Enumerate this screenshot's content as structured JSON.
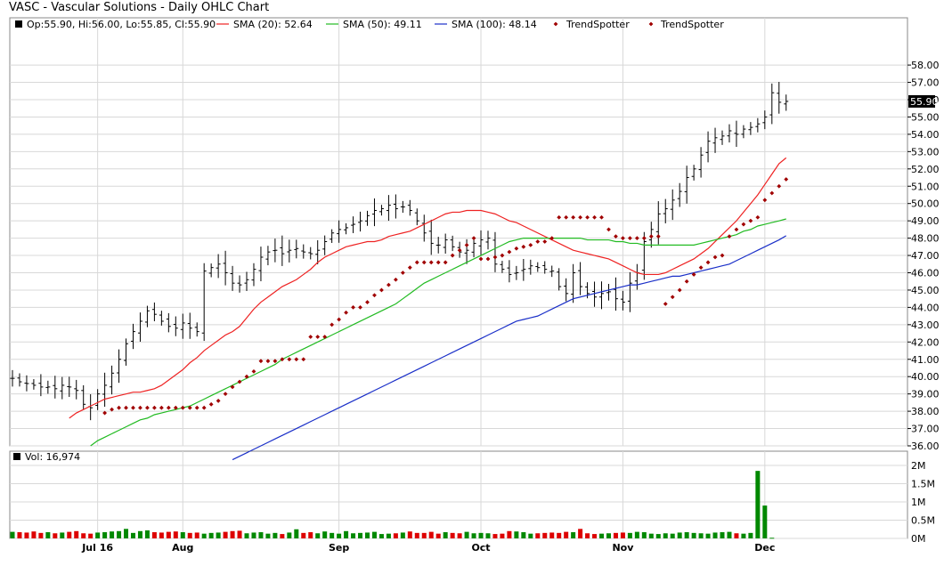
{
  "title": "VASC - Vascular Solutions - Daily OHLC Chart",
  "legend": {
    "ohlc": "Op:55.90, Hi:56.00, Lo:55.85, Cl:55.90",
    "sma20": "SMA (20): 52.64",
    "sma50": "SMA (50): 49.11",
    "sma100": "SMA (100): 48.14",
    "trend1": "TrendSpotter",
    "trend2": "TrendSpotter"
  },
  "volume_label": "Vol: 16,974",
  "last_price_tag": "55.90",
  "colors": {
    "sma20": "#ee2222",
    "sma50": "#22bb22",
    "sma100": "#1a2fc8",
    "trend": "#a00000",
    "vol_up": "#008800",
    "vol_down": "#dd0000",
    "grid": "#d8d8d8"
  },
  "chart_data": {
    "type": "ohlc",
    "price_axis": {
      "range": [
        36,
        58
      ],
      "ticks": [
        "36.00",
        "37.00",
        "38.00",
        "39.00",
        "40.00",
        "41.00",
        "42.00",
        "43.00",
        "44.00",
        "45.00",
        "46.00",
        "47.00",
        "48.00",
        "49.00",
        "50.00",
        "51.00",
        "52.00",
        "53.00",
        "54.00",
        "55.00",
        "56.00",
        "57.00",
        "58.00"
      ]
    },
    "volume_axis": {
      "range": [
        0,
        2000000
      ],
      "ticks": [
        "0M",
        "0.5M",
        "1M",
        "1.5M",
        "2M"
      ]
    },
    "x_labels": [
      {
        "label": "Jul 16",
        "index": 12
      },
      {
        "label": "Aug",
        "index": 24
      },
      {
        "label": "Sep",
        "index": 46
      },
      {
        "label": "Oct",
        "index": 66
      },
      {
        "label": "Nov",
        "index": 86
      },
      {
        "label": "Dec",
        "index": 106
      }
    ],
    "closes": [
      39.9,
      39.7,
      39.6,
      39.5,
      39.4,
      39.4,
      39.3,
      39.5,
      39.4,
      39.2,
      38.4,
      38.2,
      39.0,
      39.5,
      40.2,
      41.0,
      41.9,
      42.6,
      43.2,
      43.8,
      43.6,
      43.2,
      42.9,
      42.8,
      43.1,
      42.8,
      42.6,
      46.1,
      46.3,
      46.5,
      46.0,
      45.4,
      45.3,
      45.6,
      46.2,
      46.9,
      47.2,
      47.3,
      47.1,
      47.3,
      47.4,
      47.2,
      47.1,
      47.3,
      47.8,
      48.3,
      48.5,
      48.6,
      48.8,
      49.0,
      49.3,
      49.6,
      49.7,
      49.9,
      49.7,
      49.8,
      49.6,
      49.0,
      48.3,
      47.7,
      47.6,
      47.9,
      47.5,
      47.2,
      47.3,
      47.7,
      47.9,
      48.0,
      46.5,
      46.2,
      45.9,
      46.0,
      46.2,
      46.4,
      46.3,
      46.2,
      46.1,
      45.2,
      44.8,
      46.0,
      45.2,
      44.8,
      44.6,
      44.8,
      44.9,
      44.5,
      44.3,
      45.4,
      46.0,
      47.8,
      48.5,
      49.4,
      49.7,
      50.2,
      50.7,
      51.5,
      52.0,
      52.8,
      53.6,
      53.8,
      53.9,
      54.2,
      54.0,
      54.3,
      54.4,
      54.6,
      55.0,
      56.4,
      55.85,
      55.9
    ],
    "series": [
      {
        "name": "SMA (20)",
        "values": [
          37.6,
          37.9,
          38.1,
          38.3,
          38.5,
          38.7,
          38.8,
          38.9,
          39.0,
          39.1,
          39.1,
          39.2,
          39.3,
          39.5,
          39.8,
          40.1,
          40.4,
          40.8,
          41.1,
          41.5,
          41.8,
          42.1,
          42.4,
          42.6,
          42.9,
          43.4,
          43.9,
          44.3,
          44.6,
          44.9,
          45.2,
          45.4,
          45.6,
          45.9,
          46.2,
          46.6,
          46.9,
          47.1,
          47.3,
          47.5,
          47.6,
          47.7,
          47.8,
          47.8,
          47.9,
          48.1,
          48.2,
          48.3,
          48.4,
          48.6,
          48.8,
          49.0,
          49.2,
          49.4,
          49.5,
          49.5,
          49.6,
          49.6,
          49.6,
          49.5,
          49.4,
          49.2,
          49.0,
          48.9,
          48.7,
          48.5,
          48.3,
          48.1,
          47.9,
          47.7,
          47.5,
          47.3,
          47.2,
          47.1,
          47.0,
          46.9,
          46.8,
          46.6,
          46.4,
          46.2,
          46.0,
          45.9,
          45.9,
          45.9,
          46.0,
          46.2,
          46.4,
          46.6,
          46.8,
          47.1,
          47.4,
          47.8,
          48.2,
          48.6,
          49.0,
          49.5,
          50.0,
          50.5,
          51.1,
          51.7,
          52.3,
          52.64
        ]
      },
      {
        "name": "SMA (50)",
        "values": [
          36.0,
          36.3,
          36.5,
          36.7,
          36.9,
          37.1,
          37.3,
          37.5,
          37.6,
          37.8,
          37.9,
          38.0,
          38.1,
          38.2,
          38.3,
          38.5,
          38.7,
          38.9,
          39.1,
          39.3,
          39.5,
          39.7,
          39.9,
          40.1,
          40.3,
          40.5,
          40.7,
          41.0,
          41.2,
          41.4,
          41.6,
          41.8,
          42.0,
          42.2,
          42.4,
          42.6,
          42.8,
          43.0,
          43.2,
          43.4,
          43.6,
          43.8,
          44.0,
          44.2,
          44.5,
          44.8,
          45.1,
          45.4,
          45.6,
          45.8,
          46.0,
          46.2,
          46.4,
          46.6,
          46.8,
          47.0,
          47.2,
          47.4,
          47.6,
          47.8,
          47.9,
          48.0,
          48.0,
          48.0,
          48.0,
          48.0,
          48.0,
          48.0,
          48.0,
          48.0,
          47.9,
          47.9,
          47.9,
          47.9,
          47.8,
          47.8,
          47.7,
          47.7,
          47.6,
          47.6,
          47.6,
          47.6,
          47.6,
          47.6,
          47.6,
          47.6,
          47.7,
          47.8,
          47.9,
          48.0,
          48.1,
          48.2,
          48.4,
          48.5,
          48.7,
          48.8,
          48.9,
          49.0,
          49.11
        ]
      },
      {
        "name": "SMA (100)",
        "values": [
          35.2,
          35.4,
          35.6,
          35.8,
          36.0,
          36.2,
          36.4,
          36.6,
          36.8,
          37.0,
          37.2,
          37.4,
          37.6,
          37.8,
          38.0,
          38.2,
          38.4,
          38.6,
          38.8,
          39.0,
          39.2,
          39.4,
          39.6,
          39.8,
          40.0,
          40.2,
          40.4,
          40.6,
          40.8,
          41.0,
          41.2,
          41.4,
          41.6,
          41.8,
          42.0,
          42.2,
          42.4,
          42.6,
          42.8,
          43.0,
          43.2,
          43.3,
          43.4,
          43.5,
          43.7,
          43.9,
          44.1,
          44.3,
          44.5,
          44.6,
          44.7,
          44.8,
          44.9,
          45.0,
          45.1,
          45.2,
          45.3,
          45.3,
          45.4,
          45.5,
          45.6,
          45.7,
          45.8,
          45.8,
          45.9,
          46.0,
          46.1,
          46.2,
          46.3,
          46.4,
          46.5,
          46.7,
          46.9,
          47.1,
          47.3,
          47.5,
          47.7,
          47.9,
          48.14
        ]
      },
      {
        "name": "TrendSpotter",
        "values": [
          37.9,
          38.1,
          38.2,
          38.2,
          38.2,
          38.2,
          38.2,
          38.2,
          38.2,
          38.2,
          38.2,
          38.2,
          38.2,
          38.2,
          38.2,
          38.4,
          38.6,
          39.0,
          39.4,
          39.7,
          40.0,
          40.3,
          40.9,
          40.9,
          40.9,
          41.0,
          41.0,
          41.0,
          41.0,
          42.3,
          42.3,
          42.3,
          43.0,
          43.3,
          43.7,
          44.0,
          44.0,
          44.3,
          44.7,
          45.0,
          45.3,
          45.6,
          46.0,
          46.3,
          46.6,
          46.6,
          46.6,
          46.6,
          46.6,
          47.0,
          47.3,
          47.6,
          48.0,
          46.8,
          46.8,
          46.9,
          47.0,
          47.2,
          47.4,
          47.5,
          47.6,
          47.8,
          47.8,
          48.0,
          49.2,
          49.2,
          49.2,
          49.2,
          49.2,
          49.2,
          49.2,
          48.5,
          48.1,
          48.0,
          48.0,
          48.0,
          48.0,
          48.1,
          48.1,
          44.2,
          44.6,
          45.0,
          45.5,
          45.9,
          46.3,
          46.6,
          46.9,
          47.0,
          48.1,
          48.5,
          48.8,
          49.0,
          49.2,
          50.2,
          50.6,
          51.0,
          51.4
        ]
      }
    ],
    "volumes": [
      180000,
      170000,
      160000,
      190000,
      150000,
      170000,
      140000,
      160000,
      180000,
      200000,
      140000,
      130000,
      160000,
      170000,
      190000,
      200000,
      260000,
      150000,
      200000,
      220000,
      170000,
      160000,
      180000,
      190000,
      170000,
      150000,
      160000,
      130000,
      150000,
      160000,
      180000,
      200000,
      210000,
      140000,
      160000,
      170000,
      130000,
      150000,
      120000,
      160000,
      250000,
      150000,
      170000,
      140000,
      190000,
      150000,
      130000,
      200000,
      140000,
      150000,
      160000,
      180000,
      120000,
      130000,
      140000,
      160000,
      190000,
      150000,
      150000,
      180000,
      130000,
      170000,
      150000,
      140000,
      180000,
      140000,
      150000,
      140000,
      120000,
      130000,
      200000,
      190000,
      170000,
      130000,
      140000,
      150000,
      160000,
      150000,
      180000,
      170000,
      260000,
      140000,
      120000,
      130000,
      140000,
      150000,
      160000,
      150000,
      180000,
      170000,
      130000,
      120000,
      140000,
      130000,
      160000,
      170000,
      150000,
      140000,
      130000,
      160000,
      170000,
      180000,
      140000,
      130000,
      150000,
      1850000,
      900000,
      16974
    ]
  }
}
